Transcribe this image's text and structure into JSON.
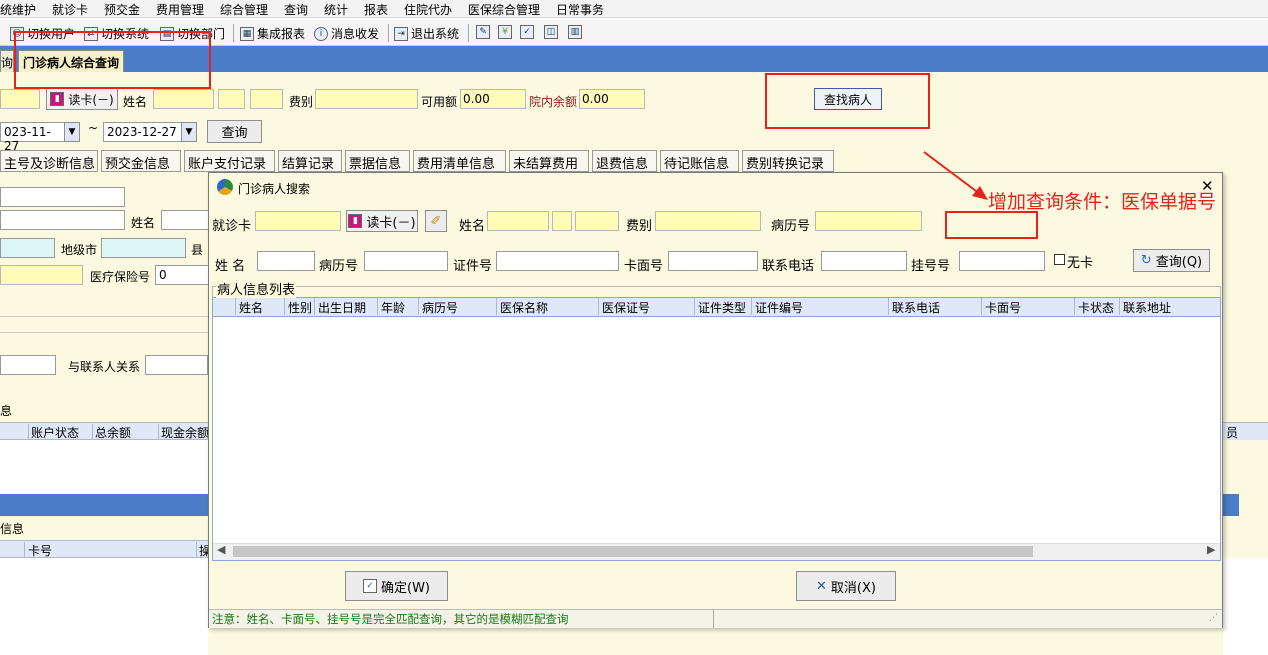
{
  "menu": [
    "统维护",
    "就诊卡",
    "预交金",
    "费用管理",
    "综合管理",
    "查询",
    "统计",
    "报表",
    "住院代办",
    "医保综合管理",
    "日常事务"
  ],
  "toolbar": {
    "switch_user": "切换用户",
    "switch_system": "切换系统",
    "switch_dept": "切换部门",
    "report": "集成报表",
    "message": "消息收发",
    "exit": "退出系统"
  },
  "tabs": {
    "partial": "询",
    "active": "门诊病人综合查询"
  },
  "main": {
    "read_card": "读卡(－)",
    "name_label": "姓名",
    "fee_label": "费别",
    "avail_label": "可用额",
    "avail_value": "0.00",
    "hosp_balance_label": "院内余额",
    "hosp_balance_value": "0.00",
    "find_patient": "查找病人",
    "date_from": "023-11-27",
    "date_sep": "~",
    "date_to": "2023-12-27",
    "query": "查询",
    "patient_tabs": [
      "主号及诊断信息",
      "预交金信息",
      "账户支付记录",
      "结算记录",
      "票据信息",
      "费用清单信息",
      "未结算费用",
      "退费信息",
      "待记账信息",
      "费别转换记录"
    ],
    "name2_label": "姓名",
    "city_label": "地级市",
    "county_label": "县",
    "insurance_label": "医疗保险号",
    "insurance_value": "0",
    "relation_label": "与联系人关系",
    "sec_info": "息",
    "acct_cols": [
      "账户状态",
      "总余额",
      "现金余额"
    ],
    "right_partial": "员",
    "sec_info2": "信息",
    "card_col": "卡号",
    "col_partial": "操"
  },
  "annotation": "增加查询条件：医保单据号",
  "dialog": {
    "title": "门诊病人搜索",
    "card_label": "就诊卡",
    "read_card": "读卡(－)",
    "name_label": "姓名",
    "fee_label": "费别",
    "record_label": "病历号",
    "name2_label": "姓 名",
    "record2_label": "病历号",
    "id_label": "证件号",
    "cardface_label": "卡面号",
    "phone_label": "联系电话",
    "reg_label": "挂号号",
    "nocard_label": "无卡",
    "query_btn": "查询(Q)",
    "list_title": "病人信息列表",
    "columns": [
      "姓名",
      "性别",
      "出生日期",
      "年龄",
      "病历号",
      "医保名称",
      "医保证号",
      "证件类型",
      "证件编号",
      "联系电话",
      "卡面号",
      "卡状态",
      "联系地址"
    ],
    "ok_btn": "确定(W)",
    "cancel_btn": "取消(X)",
    "status_note": "注意：姓名、卡面号、挂号号是完全匹配查询，其它的是模糊匹配查询"
  },
  "colors": {
    "tab_blue": "#4a7cc7",
    "highlight_red": "#e8221b",
    "panel": "#fbf9df",
    "field_yellow": "#fffcb8",
    "status_green": "#1a7a1a"
  }
}
